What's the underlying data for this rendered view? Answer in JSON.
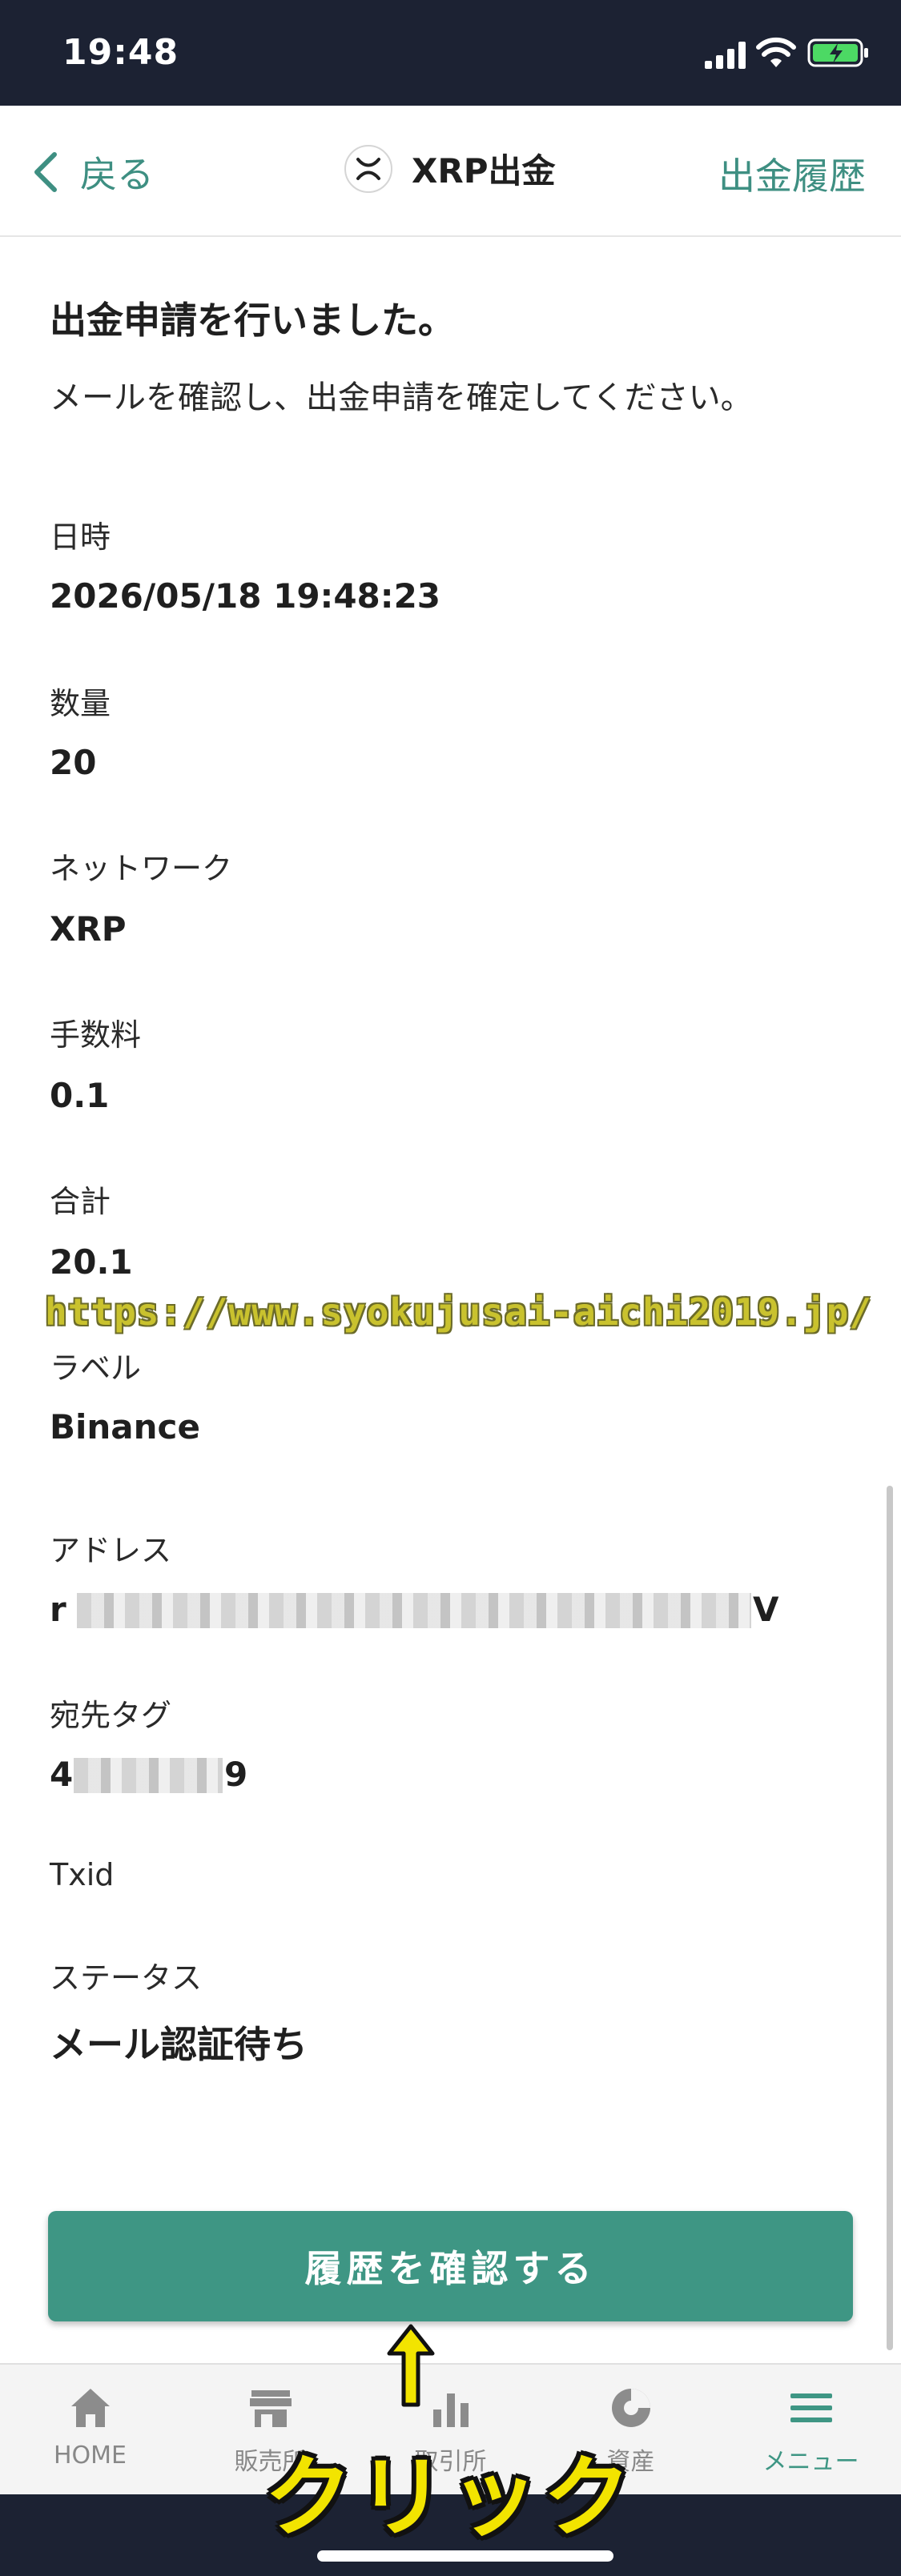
{
  "status_bar": {
    "time": "19:48"
  },
  "header": {
    "back_label": "戻る",
    "title": "XRP出金",
    "history_link": "出金履歴"
  },
  "message": {
    "headline": "出金申請を行いました。",
    "subline": "メールを確認し、出金申請を確定してください。"
  },
  "fields": {
    "datetime": {
      "label": "日時",
      "value": "2026/05/18 19:48:23"
    },
    "amount": {
      "label": "数量",
      "value": "20"
    },
    "network": {
      "label": "ネットワーク",
      "value": "XRP"
    },
    "fee": {
      "label": "手数料",
      "value": "0.1"
    },
    "total": {
      "label": "合計",
      "value": "20.1"
    },
    "tag_label": {
      "label": "ラベル",
      "value": "Binance"
    },
    "address": {
      "label": "アドレス",
      "prefix": "r",
      "suffix": "V"
    },
    "destination_tag": {
      "label": "宛先タグ",
      "prefix": "4",
      "suffix": "9"
    },
    "txid": {
      "label": "Txid"
    },
    "status": {
      "label": "ステータス",
      "value": "メール認証待ち"
    }
  },
  "primary_button": {
    "label": "履歴を確認する"
  },
  "tabbar": {
    "items": [
      {
        "label": "HOME",
        "icon": "home-icon"
      },
      {
        "label": "販売所",
        "icon": "store-icon"
      },
      {
        "label": "取引所",
        "icon": "bar-chart-icon"
      },
      {
        "label": "資産",
        "icon": "pie-chart-icon"
      },
      {
        "label": "メニュー",
        "icon": "menu-icon",
        "active": true
      }
    ]
  },
  "overlay": {
    "watermark": "https://www.syokujusai-aichi2019.jp/",
    "click_label": "クリック"
  },
  "colors": {
    "accent": "#3e9684",
    "statusbar": "#1c2233",
    "annotation": "#f2e400"
  }
}
